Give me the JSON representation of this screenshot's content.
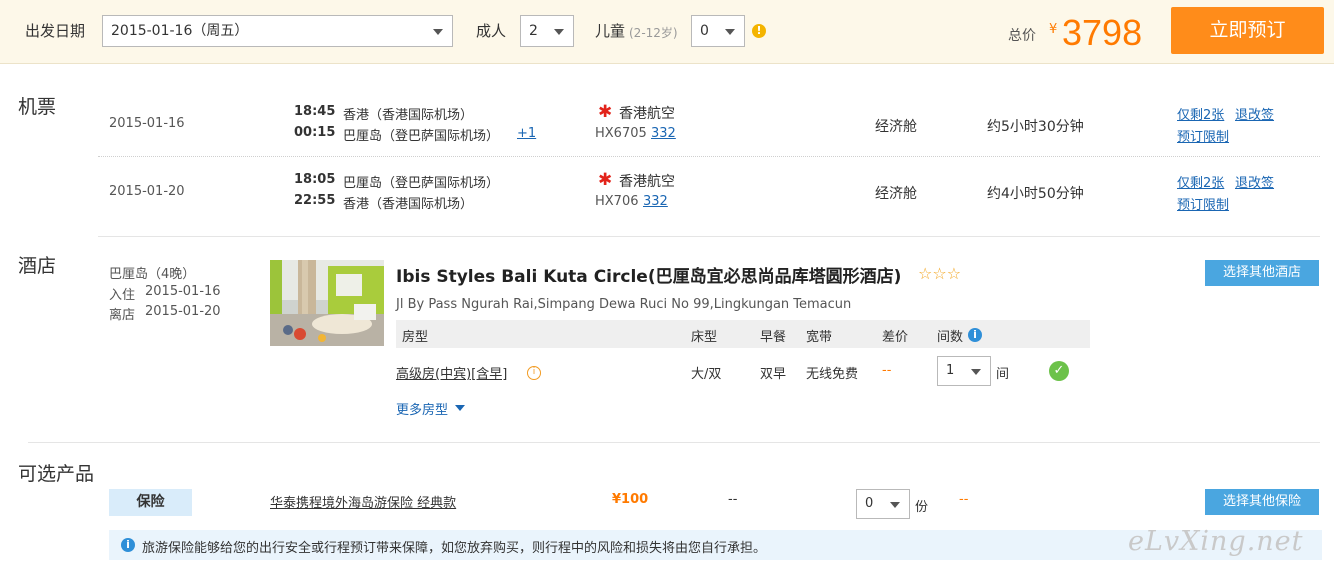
{
  "search": {
    "depart_label": "出发日期",
    "depart_value": "2015-01-16（周五）",
    "adult_label": "成人",
    "adult_value": "2",
    "child_label": "儿童",
    "child_hint": "(2-12岁)",
    "child_value": "0",
    "warn_icon": "!",
    "total_label": "总价",
    "currency": "¥",
    "total_price": "3798",
    "book_button": "立即预订"
  },
  "flight": {
    "section_title": "机票",
    "legs": [
      {
        "date": "2015-01-16",
        "dep_time": "18:45",
        "dep_place": "香港（香港国际机场）",
        "arr_time": "00:15",
        "arr_place": "巴厘岛（登巴萨国际机场）",
        "next_day": "+1",
        "airline": "香港航空",
        "flight_no": "HX6705",
        "aircraft": "332",
        "cabin": "经济舱",
        "duration": "约5小时30分钟",
        "remain": "仅剩2张",
        "refund": "退改签",
        "limit": "预订限制"
      },
      {
        "date": "2015-01-20",
        "dep_time": "18:05",
        "dep_place": "巴厘岛（登巴萨国际机场）",
        "arr_time": "22:55",
        "arr_place": "香港（香港国际机场）",
        "airline": "香港航空",
        "flight_no": "HX706",
        "aircraft": "332",
        "cabin": "经济舱",
        "duration": "约4小时50分钟",
        "remain": "仅剩2张",
        "refund": "退改签",
        "limit": "预订限制"
      }
    ]
  },
  "hotel": {
    "section_title": "酒店",
    "city_nights": "巴厘岛（4晚）",
    "checkin_label": "入住",
    "checkin_date": "2015-01-16",
    "checkout_label": "离店",
    "checkout_date": "2015-01-20",
    "name": "Ibis Styles Bali Kuta Circle(巴厘岛宜必思尚品库塔圆形酒店)",
    "stars": "☆☆☆",
    "address": "Jl By Pass Ngurah Rai,Simpang Dewa Ruci No 99,Lingkungan Temacun",
    "change_button": "选择其他酒店",
    "table_headers": {
      "room": "房型",
      "bed": "床型",
      "breakfast": "早餐",
      "broadband": "宽带",
      "diff": "差价",
      "count": "间数"
    },
    "room": {
      "name": "高级房(中宾)[含早]",
      "bed": "大/双",
      "breakfast": "双早",
      "broadband": "无线免费",
      "diff": "--",
      "count": "1",
      "unit": "间"
    },
    "more_rooms": "更多房型"
  },
  "extras": {
    "section_title": "可选产品",
    "tag": "保险",
    "product_name": "华泰携程境外海岛游保险 经典款",
    "price": "¥100",
    "col_dash": "--",
    "qty": "0",
    "qty_unit": "份",
    "diff": "--",
    "change_button": "选择其他保险",
    "notice": "旅游保险能够给您的出行安全或行程预订带来保障，如您放弃购买，则行程中的风险和损失将由您自行承担。"
  },
  "watermark": "eLvXing.net"
}
